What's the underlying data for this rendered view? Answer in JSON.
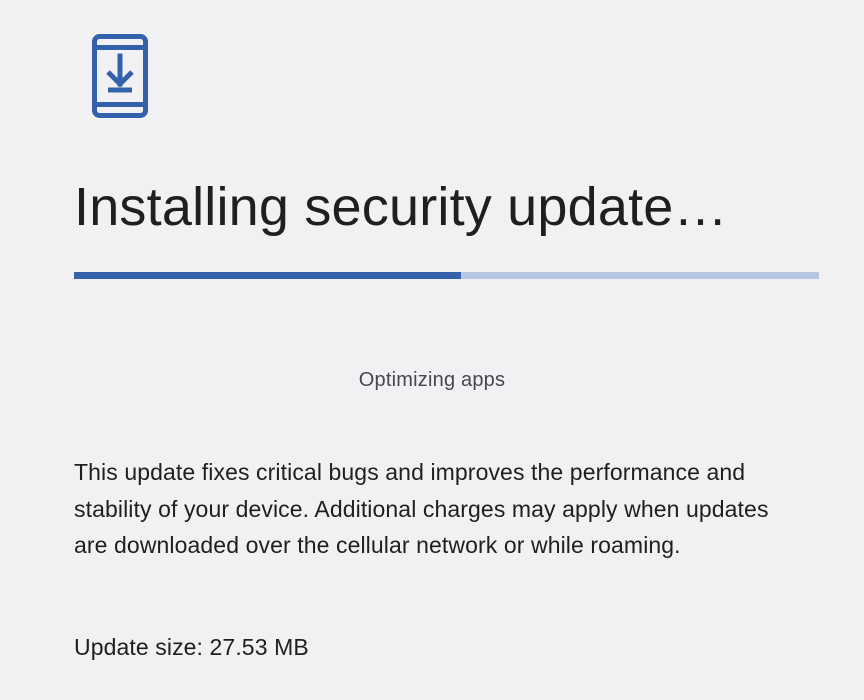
{
  "screen": {
    "icon": "system-update-icon",
    "title": "Installing security update…",
    "progress": 0.52,
    "status": "Optimizing apps",
    "description": "This update fixes critical bugs and improves the performance and stability of your device. Additional charges may apply when updates are downloaded over the cellular network or while roaming.",
    "size": "Update size: 27.53 MB"
  },
  "colors": {
    "background": "#f1f1f4",
    "accent": "#3461ab",
    "track": "#b7c7e1",
    "text": "#1f1f1f",
    "secondary_text": "#454652"
  }
}
